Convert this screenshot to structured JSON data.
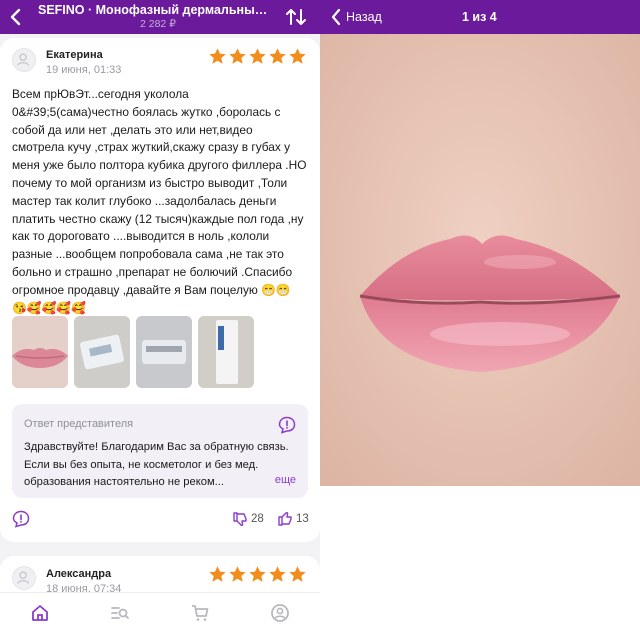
{
  "left_header": {
    "title": "SEFINO · Монофазный дермальный фи...",
    "price": "2 282 ₽"
  },
  "review1": {
    "author": "Екатерина",
    "date": "19 июня, 01:33",
    "rating": 5,
    "text": "Всем прЮвЭт...сегодня уколола\n0&#39;5(сама)честно боялась жутко ,боролась с\nсобой да или нет ,делать это или нет,видео\nсмотрела кучу ,страх жуткий,скажу сразу в губах у\nменя уже было полтора кубика другого филлера .НО\nпочему то мой организм из быстро выводит ,Толи\nмастер так колит глубоко ...задолбалась деньги\nплатить честно скажу (12 тысяч)каждые пол года ,ну\nкак то дороговато ....выводится в ноль ,кололи\nразные ...вообщем попробовала сама ,не так это\nбольно и страшно ,препарат не болючий .Спасибо\nогромное продавцу ,давайте я Вам поцелую 😁😁\n😘🥰🥰🥰🥰",
    "photo_count": 4,
    "reply": {
      "title": "Ответ представителя",
      "text": "Здравствуйте! Благодарим Вас за обратную связь. Если вы без опыта, не косметолог и без мед. образования настоятельно не реком...",
      "more": "еще"
    },
    "dislikes": "28",
    "likes": "13"
  },
  "review2": {
    "author": "Александра",
    "date": "18 июня, 07:34",
    "rating": 5
  },
  "right_header": {
    "back_label": "Назад",
    "counter": "1 из 4"
  },
  "colors": {
    "header": "#6a1a9a",
    "star": "#f28c1b",
    "accent": "#8a3ccd"
  }
}
